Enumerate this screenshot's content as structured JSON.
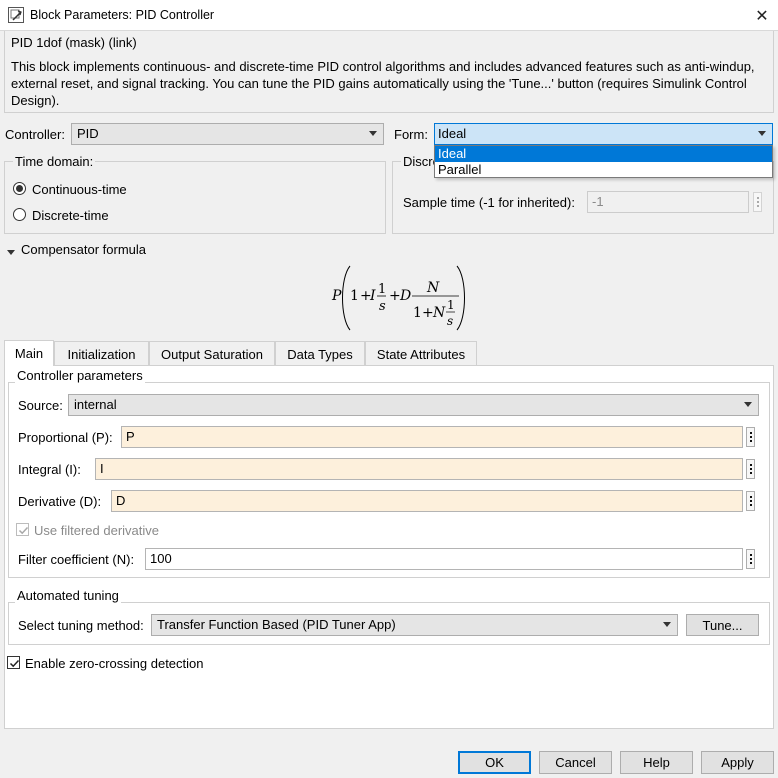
{
  "window": {
    "title": "Block Parameters: PID Controller"
  },
  "header": {
    "mask_title": "PID 1dof (mask) (link)",
    "description": "This block implements continuous- and discrete-time PID control algorithms and includes advanced features such as anti-windup, external reset, and signal tracking. You can tune the PID gains automatically using the 'Tune...' button (requires Simulink Control Design)."
  },
  "controller": {
    "label": "Controller:",
    "value": "PID"
  },
  "form": {
    "label": "Form:",
    "value": "Ideal",
    "options": [
      "Ideal",
      "Parallel"
    ]
  },
  "time_domain": {
    "title": "Time domain:",
    "continuous": "Continuous-time",
    "discrete": "Discrete-time"
  },
  "discrete_panel": {
    "title_partial": "Discre",
    "sample_time_label": "Sample time (-1 for inherited):",
    "sample_time_value": "-1"
  },
  "compensator": {
    "label": "Compensator formula",
    "symbols": {
      "P": "P",
      "one": "1",
      "plus": "+",
      "I": "I",
      "D": "D",
      "N": "N",
      "s": "s"
    }
  },
  "tabs": [
    {
      "label": "Main"
    },
    {
      "label": "Initialization"
    },
    {
      "label": "Output Saturation"
    },
    {
      "label": "Data Types"
    },
    {
      "label": "State Attributes"
    }
  ],
  "controller_parameters": {
    "title": "Controller parameters",
    "source_label": "Source:",
    "source_value": "internal",
    "proportional_label": "Proportional (P):",
    "proportional_value": "P",
    "integral_label": "Integral (I):",
    "integral_value": "I",
    "derivative_label": "Derivative (D):",
    "derivative_value": "D",
    "filtered_derivative_label": "Use filtered derivative",
    "filter_coeff_label": "Filter coefficient (N):",
    "filter_coeff_value": "100"
  },
  "automated_tuning": {
    "title": "Automated tuning",
    "method_label": "Select tuning method:",
    "method_value": "Transfer Function Based (PID Tuner App)",
    "tune_button": "Tune..."
  },
  "zero_crossing": {
    "label": "Enable zero-crossing detection"
  },
  "buttons": {
    "ok": "OK",
    "cancel": "Cancel",
    "help": "Help",
    "apply": "Apply"
  },
  "colors": {
    "accent": "#0078d7",
    "field_bg": "#fdf0dc",
    "dialog_bg": "#f0f0f0"
  }
}
